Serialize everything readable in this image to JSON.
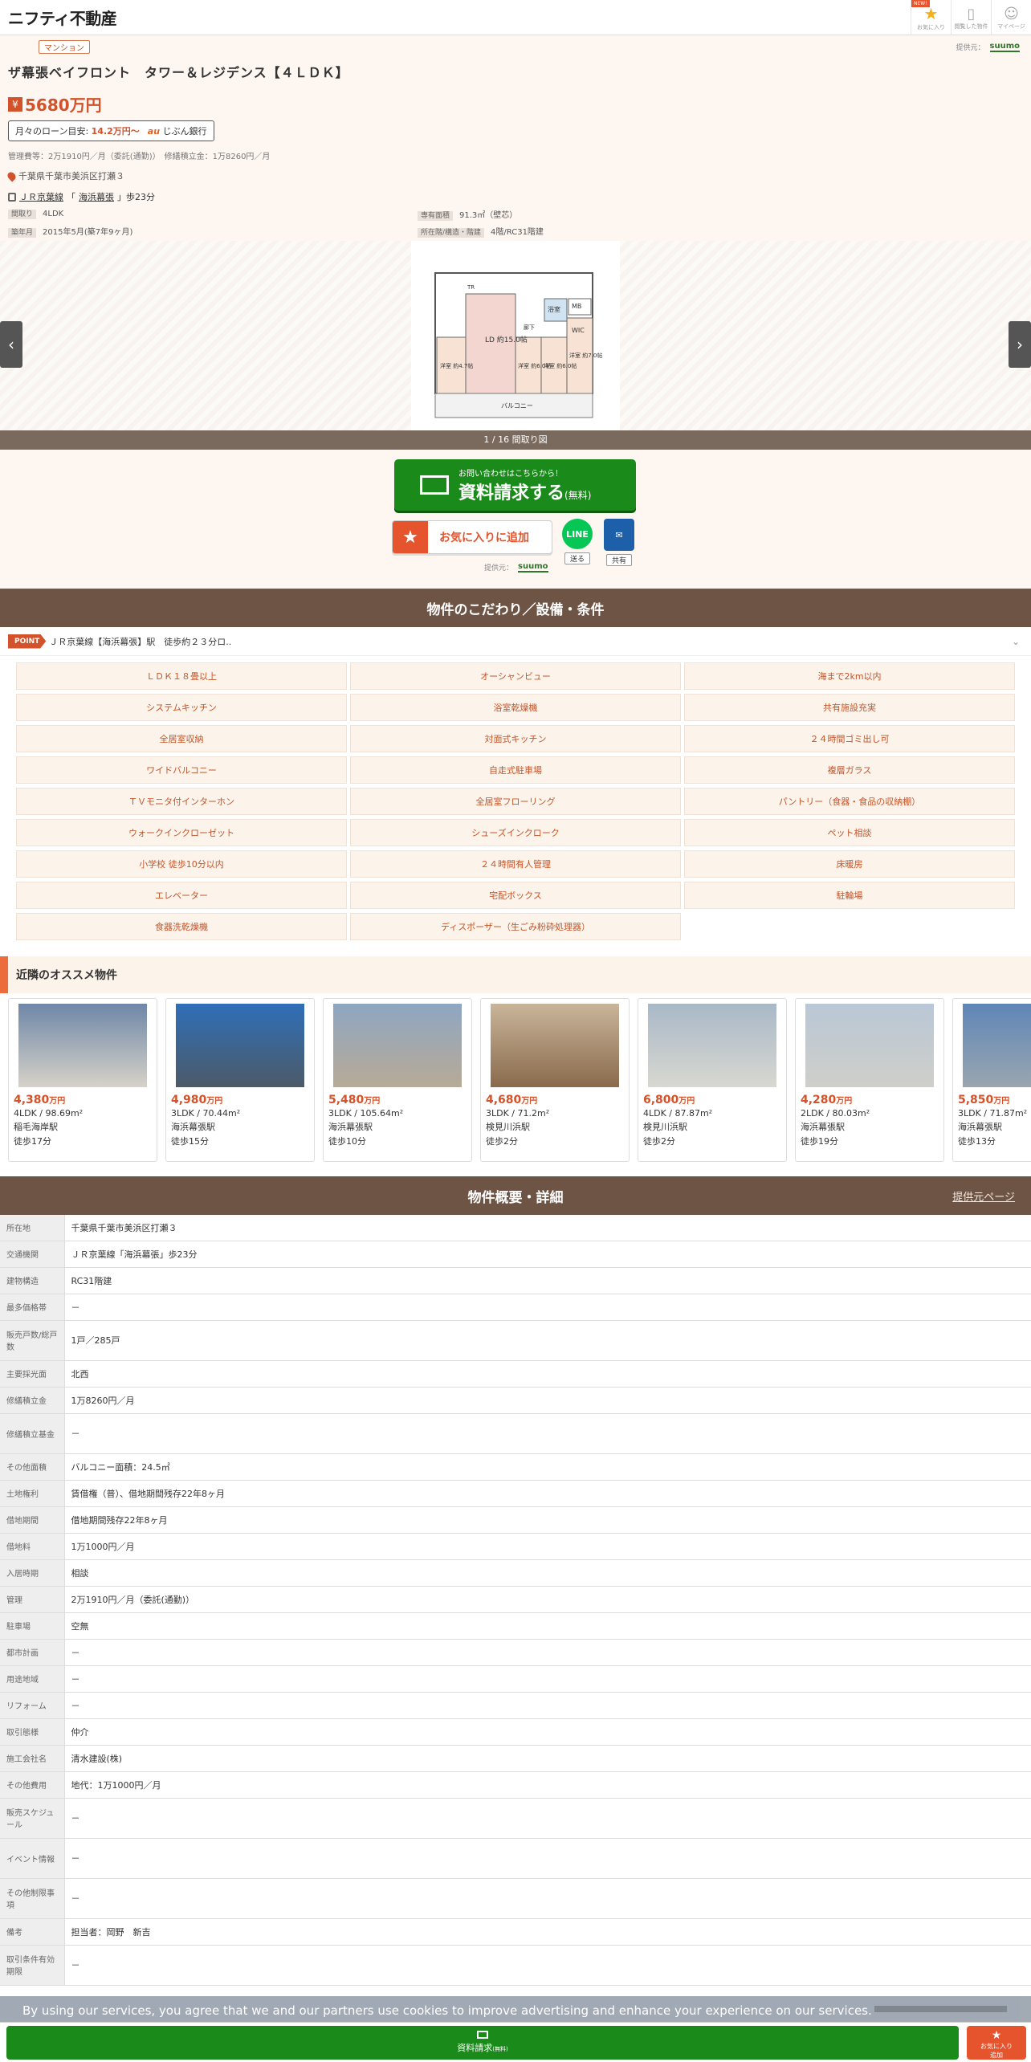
{
  "header": {
    "logo": "ニフティ不動産",
    "icons": [
      {
        "name": "favorites",
        "label": "お気に入り",
        "new": "NEW!"
      },
      {
        "name": "history",
        "label": "閲覧した物件"
      },
      {
        "name": "mypage",
        "label": "マイページ"
      }
    ]
  },
  "summary": {
    "type_tag": "マンション",
    "provider_label": "提供元：",
    "provider_name": "suumo",
    "title": "ザ幕張ベイフロント　タワー＆レジデンス【４ＬＤＫ】",
    "yen_icon": "¥",
    "price": "5680万円",
    "loan_label": "月々のローン目安:",
    "loan_amount": "14.2万円〜",
    "loan_bank_logo": "au",
    "loan_bank": "じぶん銀行",
    "fees": "管理費等：2万1910円／月（委託(通勤)）　修繕積立金：1万8260円／月",
    "address": "千葉県千葉市美浜区打瀬３",
    "station_line": "ＪＲ京葉線",
    "station_open": "「",
    "station_name": "海浜幕張",
    "station_rest": "」歩23分",
    "specs": [
      {
        "label": "間取り",
        "value": "4LDK"
      },
      {
        "label": "専有面積",
        "value": "91.3㎡（壁芯）"
      },
      {
        "label": "築年月",
        "value": "2015年5月(築7年9ヶ月)"
      },
      {
        "label": "所在階/構造・階建",
        "value": "4階/RC31階建"
      }
    ]
  },
  "gallery": {
    "caption": "1 / 16 間取り図",
    "prev": "‹",
    "next": "›",
    "floorplan": {
      "rooms": [
        "LD 約15.0帖",
        "洋室 約4.7帖",
        "洋室 約6.0帖",
        "洋室 約6.0帖",
        "洋室 約7.0帖",
        "バルコニー",
        "WIC",
        "浴室",
        "MB",
        "TR",
        "廊下"
      ]
    }
  },
  "cta": {
    "request_small": "お問い合わせはこちらから！",
    "request_big": "資料請求する",
    "request_free": "(無料)",
    "fav_icon": "★",
    "fav_label": "お気に入りに追加",
    "line_label": "LINE",
    "line_cap": "送る",
    "mail_cap": "共有",
    "provider_label": "提供元：",
    "provider_name": "suumo"
  },
  "features": {
    "title": "物件のこだわり／設備・条件",
    "point_badge": "POINT",
    "point_text": "ＪＲ京葉線【海浜幕張】駅　徒歩約２３分ロ..",
    "expand_icon": "⌄",
    "items": [
      "ＬＤＫ１８畳以上",
      "オーシャンビュー",
      "海まで2km以内",
      "システムキッチン",
      "浴室乾燥機",
      "共有施設充実",
      "全居室収納",
      "対面式キッチン",
      "２４時間ゴミ出し可",
      "ワイドバルコニー",
      "自走式駐車場",
      "複層ガラス",
      "ＴＶモニタ付インターホン",
      "全居室フローリング",
      "パントリー（食器・食品の収納棚）",
      "ウォークインクローゼット",
      "シューズインクローク",
      "ペット相談",
      "小学校 徒歩10分以内",
      "２４時間有人管理",
      "床暖房",
      "エレベーター",
      "宅配ボックス",
      "駐輪場",
      "食器洗乾燥機",
      "ディスポーザー（生ごみ粉砕処理器）"
    ]
  },
  "nearby": {
    "title": "近隣のオススメ物件",
    "items": [
      {
        "price": "4,380",
        "unit": "万円",
        "spec": "4LDK / 98.69m²",
        "station": "稲毛海岸駅",
        "walk": "徒歩17分",
        "c1": "#6f87a8",
        "c2": "#d6d2c8"
      },
      {
        "price": "4,980",
        "unit": "万円",
        "spec": "3LDK / 70.44m²",
        "station": "海浜幕張駅",
        "walk": "徒歩15分",
        "c1": "#2f6fb8",
        "c2": "#4c5a68"
      },
      {
        "price": "5,480",
        "unit": "万円",
        "spec": "3LDK / 105.64m²",
        "station": "海浜幕張駅",
        "walk": "徒歩10分",
        "c1": "#8ea6c2",
        "c2": "#b8aa96"
      },
      {
        "price": "4,680",
        "unit": "万円",
        "spec": "3LDK / 71.2m²",
        "station": "検見川浜駅",
        "walk": "徒歩2分",
        "c1": "#c9b59a",
        "c2": "#8a6a4c"
      },
      {
        "price": "6,800",
        "unit": "万円",
        "spec": "4LDK / 87.87m²",
        "station": "検見川浜駅",
        "walk": "徒歩2分",
        "c1": "#a9b8c8",
        "c2": "#d8d8d0"
      },
      {
        "price": "4,280",
        "unit": "万円",
        "spec": "2LDK / 80.03m²",
        "station": "海浜幕張駅",
        "walk": "徒歩19分",
        "c1": "#b9c7d6",
        "c2": "#cfcfc9"
      },
      {
        "price": "5,850",
        "unit": "万円",
        "spec": "3LDK / 71.87m²",
        "station": "海浜幕張駅",
        "walk": "徒歩13分",
        "c1": "#5f86b8",
        "c2": "#9aa6b0"
      }
    ]
  },
  "details": {
    "title": "物件概要・詳細",
    "link": "提供元ページ",
    "rows": [
      {
        "k": "所在地",
        "v": "千葉県千葉市美浜区打瀬３",
        "h": 32
      },
      {
        "k": "交通機関",
        "v": "ＪＲ京葉線「海浜幕張」歩23分",
        "h": 33,
        "station": true
      },
      {
        "k": "建物構造",
        "v": "RC31階建",
        "h": 33
      },
      {
        "k": "最多価格帯",
        "v": "－",
        "h": 33
      },
      {
        "k": "販売戸数/総戸数",
        "v": "1戸／285戸",
        "h": 50
      },
      {
        "k": "主要採光面",
        "v": "北西",
        "h": 33
      },
      {
        "k": "修繕積立金",
        "v": "1万8260円／月",
        "h": 33
      },
      {
        "k": "修繕積立基金",
        "v": "－",
        "h": 50
      },
      {
        "k": "その他面積",
        "v": "バルコニー面積：24.5㎡",
        "h": 33
      },
      {
        "k": "土地権利",
        "v": "賃借権（普）、借地期間残存22年8ヶ月",
        "h": 33
      },
      {
        "k": "借地期間",
        "v": "借地期間残存22年8ヶ月",
        "h": 33
      },
      {
        "k": "借地料",
        "v": "1万1000円／月",
        "h": 33
      },
      {
        "k": "入居時期",
        "v": "相談",
        "h": 33
      },
      {
        "k": "管理",
        "v": "2万1910円／月（委託(通勤)）",
        "h": 33
      },
      {
        "k": "駐車場",
        "v": "空無",
        "h": 33
      },
      {
        "k": "都市計画",
        "v": "－",
        "h": 33
      },
      {
        "k": "用途地域",
        "v": "－",
        "h": 33
      },
      {
        "k": "リフォーム",
        "v": "－",
        "h": 33
      },
      {
        "k": "取引態様",
        "v": "仲介",
        "h": 33
      },
      {
        "k": "施工会社名",
        "v": "清水建設(株)",
        "h": 33
      },
      {
        "k": "その他費用",
        "v": "地代：1万1000円／月",
        "h": 33
      },
      {
        "k": "販売スケジュール",
        "v": "－",
        "h": 50
      },
      {
        "k": "イベント情報",
        "v": "－",
        "h": 50
      },
      {
        "k": "その他制限事項",
        "v": "－",
        "h": 50
      },
      {
        "k": "備考",
        "v": "担当者：岡野　新吉",
        "h": 33
      },
      {
        "k": "取引条件有効期限",
        "v": "－",
        "h": 50
      }
    ]
  },
  "cookie": {
    "text": "By using our services, you agree that we and our partners use cookies to improve advertising and enhance your experience on our services."
  },
  "footer": {
    "request": "資料請求",
    "request_free": "(無料)",
    "fav_line1": "お気に入り",
    "fav_line2": "追加",
    "fav_icon": "★"
  },
  "colors": {
    "accent": "#d2522b",
    "brown": "#6d5445",
    "green": "#1a8a1a",
    "cream": "#fdf6f1"
  }
}
